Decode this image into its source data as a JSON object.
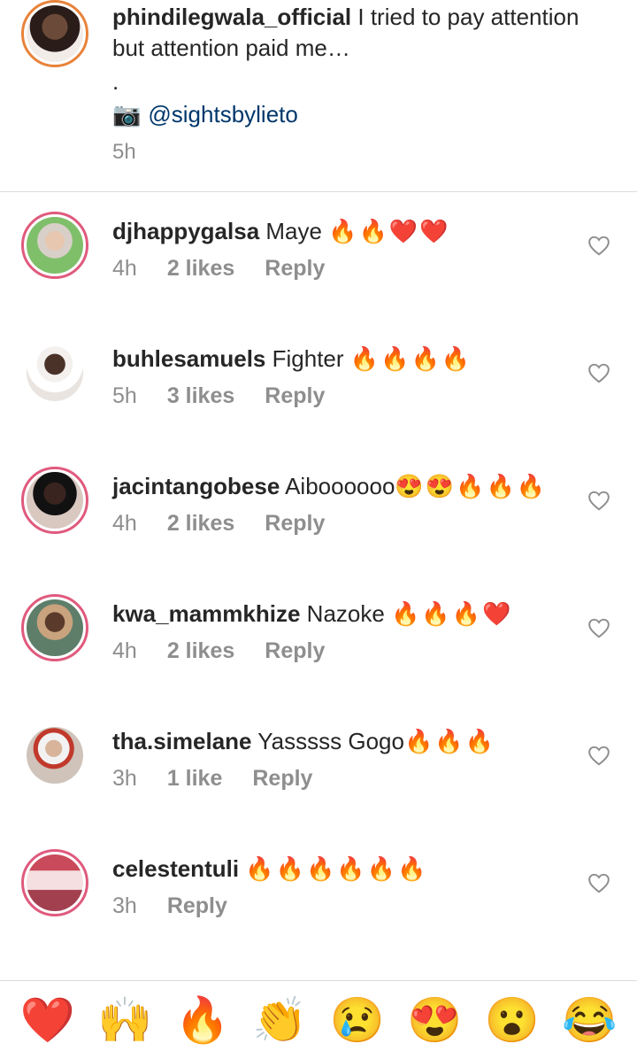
{
  "caption": {
    "username": "phindilegwala_official",
    "text": " I tried to pay attention but attention paid me…",
    "dot": ".",
    "camera_icon": "📷",
    "mention": "@sightsbylieto",
    "time": "5h",
    "avatar_color": "#3a2a2a"
  },
  "comments": [
    {
      "username": "djhappygalsa",
      "text": " Maye ",
      "emojis": "🔥🔥❤️❤️",
      "time": "4h",
      "likes": "2 likes",
      "reply": "Reply",
      "avatar_color": "#7fbf6a",
      "ring": "pink"
    },
    {
      "username": "buhlesamuels",
      "text": " Fighter ",
      "emojis": "🔥🔥🔥🔥",
      "time": "5h",
      "likes": "3 likes",
      "reply": "Reply",
      "avatar_color": "#e9e4e0",
      "ring": "none"
    },
    {
      "username": "jacintangobese",
      "text": " Aiboooooo",
      "emojis": "😍😍🔥🔥🔥",
      "time": "4h",
      "likes": "2 likes",
      "reply": "Reply",
      "avatar_color": "#d8c8c0",
      "ring": "pink"
    },
    {
      "username": "kwa_mammkhize",
      "text": " Nazoke ",
      "emojis": "🔥🔥🔥❤️",
      "time": "4h",
      "likes": "2 likes",
      "reply": "Reply",
      "avatar_color": "#5e7e6a",
      "ring": "pink"
    },
    {
      "username": "tha.simelane",
      "text": " Yasssss Gogo",
      "emojis": "🔥🔥🔥",
      "time": "3h",
      "likes": "1 like",
      "reply": "Reply",
      "avatar_color": "#cfc3ba",
      "ring": "none"
    },
    {
      "username": "celestentuli",
      "text": " ",
      "emojis": "🔥🔥🔥🔥🔥🔥",
      "time": "3h",
      "likes": "",
      "reply": "Reply",
      "avatar_color": "#c94a5a",
      "ring": "pink"
    }
  ],
  "reactions": [
    "❤️",
    "🙌",
    "🔥",
    "👏",
    "😢",
    "😍",
    "😮",
    "😂"
  ],
  "colors": {
    "meta_gray": "#8e8e8e",
    "mention_blue": "#00376b",
    "ring_pink": "#e05a7d",
    "divider": "#dbdbdb"
  }
}
